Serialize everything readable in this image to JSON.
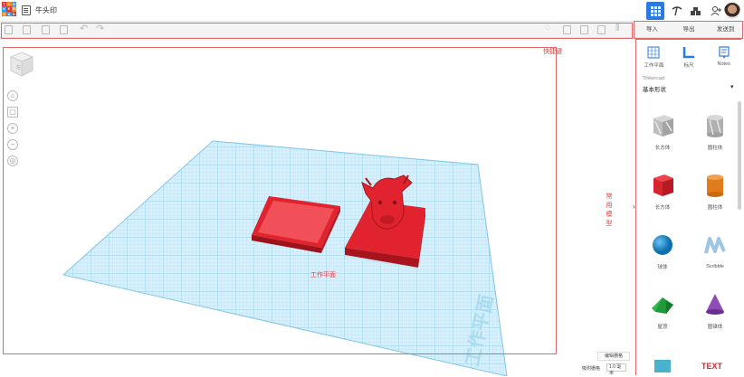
{
  "app": {
    "logo_letters": [
      "T",
      "I",
      "N",
      "K",
      "E",
      "R",
      "C",
      "A",
      "D"
    ]
  },
  "header": {
    "project_title": "牛头印"
  },
  "right_tabs": [
    "导入",
    "导出",
    "发送到"
  ],
  "side_panel": {
    "tools": [
      {
        "label": "工作平面",
        "icon": "workplane-icon"
      },
      {
        "label": "标尺",
        "icon": "ruler-icon"
      },
      {
        "label": "Notes",
        "icon": "notes-icon"
      }
    ],
    "library_source": "Tinkercad",
    "library_selected": "基本形状",
    "shapes": [
      {
        "label": "长方体",
        "icon": "box-hole-icon",
        "color": "#b8b8b8"
      },
      {
        "label": "圆柱体",
        "icon": "cylinder-hole-icon",
        "color": "#b8b8b8"
      },
      {
        "label": "长方体",
        "icon": "box-icon",
        "color": "#d8242f"
      },
      {
        "label": "圆柱体",
        "icon": "cylinder-icon",
        "color": "#e07d1a"
      },
      {
        "label": "球体",
        "icon": "sphere-icon",
        "color": "#1b8fd6"
      },
      {
        "label": "Scribble",
        "icon": "scribble-icon",
        "color": "#7fb3d5"
      },
      {
        "label": "屋顶",
        "icon": "roof-icon",
        "color": "#1f9a3a"
      },
      {
        "label": "圆锥体",
        "icon": "cone-icon",
        "color": "#7b3fa0"
      }
    ]
  },
  "annotations": {
    "shortcut": "快捷键",
    "workplane": "工作平面",
    "common_models": "常用模型"
  },
  "viewport": {
    "cube_face": "左",
    "plane_watermark": "工作平面"
  },
  "bottom": {
    "edit_grid": "编辑栅格",
    "snap_label": "吸附栅格",
    "snap_value": "1.0 毫米"
  },
  "colors": {
    "accent": "#2a7ae2",
    "annotation": "#e03b3b",
    "shape_red": "#e0232f"
  }
}
